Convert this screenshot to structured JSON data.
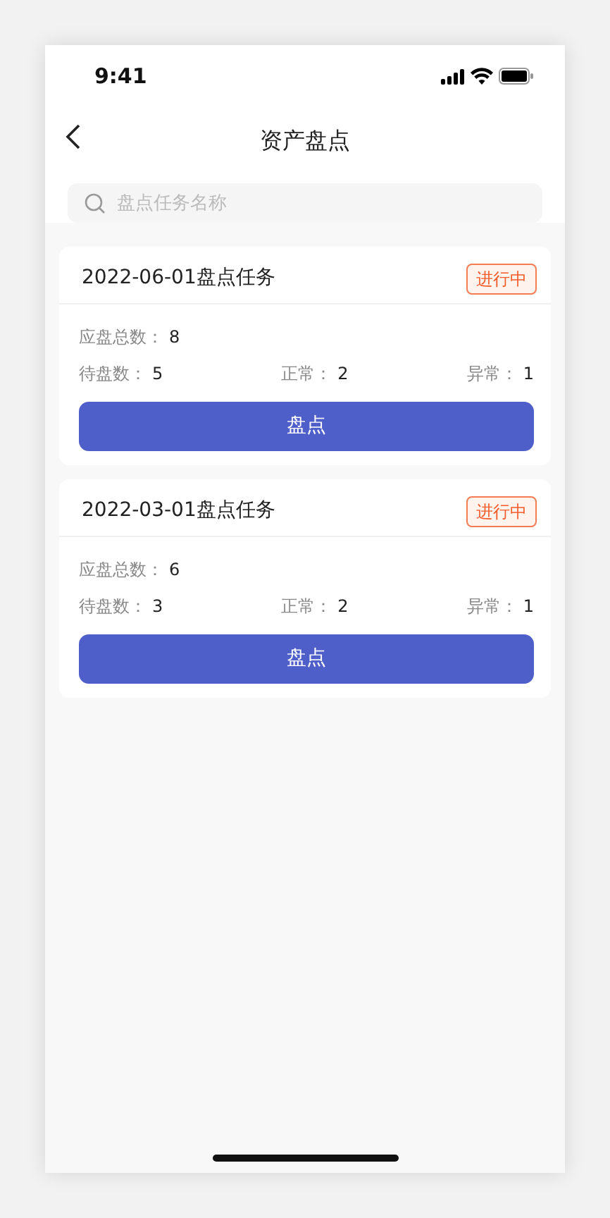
{
  "status_bar": {
    "time": "9:41"
  },
  "nav": {
    "title": "资产盘点"
  },
  "search": {
    "placeholder": "盘点任务名称"
  },
  "tasks": [
    {
      "title": "2022-06-01盘点任务",
      "status": "进行中",
      "total": {
        "label": "应盘总数：",
        "value": "8"
      },
      "stats": [
        {
          "label": "待盘数：",
          "value": "5"
        },
        {
          "label": "正常：",
          "value": "2"
        },
        {
          "label": "异常：",
          "value": "1"
        }
      ],
      "button": "盘点"
    },
    {
      "title": "2022-03-01盘点任务",
      "status": "进行中",
      "total": {
        "label": "应盘总数：",
        "value": "6"
      },
      "stats": [
        {
          "label": "待盘数：",
          "value": "3"
        },
        {
          "label": "正常：",
          "value": "2"
        },
        {
          "label": "异常：",
          "value": "1"
        }
      ],
      "button": "盘点"
    }
  ]
}
